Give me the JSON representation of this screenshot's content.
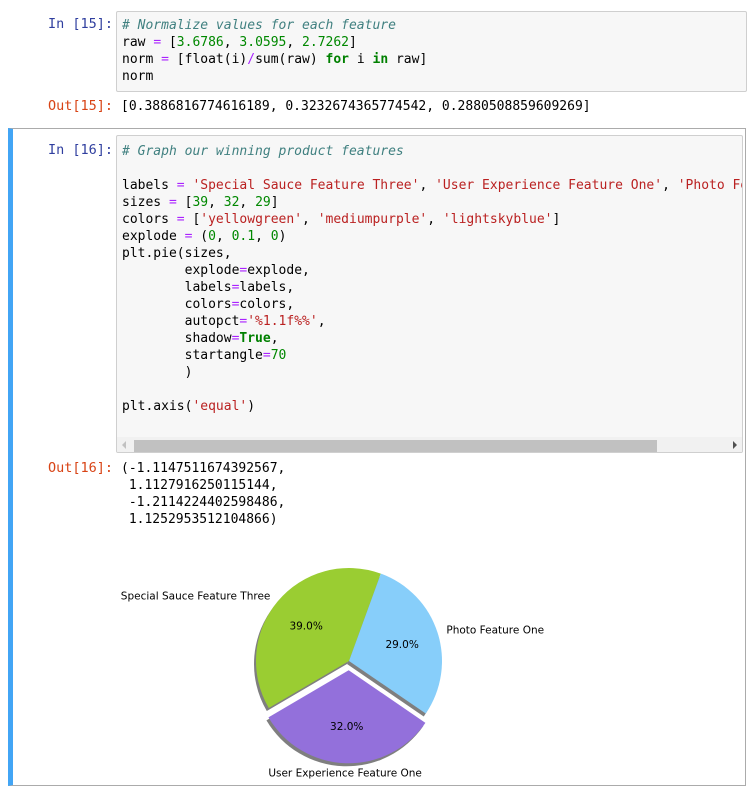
{
  "cells": [
    {
      "prompt_in": "In [15]:",
      "code_lines": [
        [
          {
            "t": "# Normalize values for each feature",
            "c": "cm"
          }
        ],
        [
          {
            "t": "raw "
          },
          {
            "t": "=",
            "c": "op"
          },
          {
            "t": " ["
          },
          {
            "t": "3.6786",
            "c": "num"
          },
          {
            "t": ", "
          },
          {
            "t": "3.0595",
            "c": "num"
          },
          {
            "t": ", "
          },
          {
            "t": "2.7262",
            "c": "num"
          },
          {
            "t": "]"
          }
        ],
        [
          {
            "t": "norm "
          },
          {
            "t": "=",
            "c": "op"
          },
          {
            "t": " [float(i)"
          },
          {
            "t": "/",
            "c": "op"
          },
          {
            "t": "sum(raw) "
          },
          {
            "t": "for",
            "c": "kw"
          },
          {
            "t": " i "
          },
          {
            "t": "in",
            "c": "kw"
          },
          {
            "t": " raw]"
          }
        ],
        [
          {
            "t": "norm"
          }
        ]
      ],
      "prompt_out": "Out[15]:",
      "output_lines": [
        "[0.3886816774616189, 0.3232674365774542, 0.2880508859609269]"
      ]
    },
    {
      "prompt_in": "In [16]:",
      "code_lines": [
        [
          {
            "t": "# Graph our winning product features",
            "c": "cm"
          }
        ],
        [
          {
            "t": ""
          }
        ],
        [
          {
            "t": "labels "
          },
          {
            "t": "=",
            "c": "op"
          },
          {
            "t": " "
          },
          {
            "t": "'Special Sauce Feature Three'",
            "c": "str"
          },
          {
            "t": ", "
          },
          {
            "t": "'User Experience Feature One'",
            "c": "str"
          },
          {
            "t": ", "
          },
          {
            "t": "'Photo Feature One'",
            "c": "str"
          }
        ],
        [
          {
            "t": "sizes "
          },
          {
            "t": "=",
            "c": "op"
          },
          {
            "t": " ["
          },
          {
            "t": "39",
            "c": "num"
          },
          {
            "t": ", "
          },
          {
            "t": "32",
            "c": "num"
          },
          {
            "t": ", "
          },
          {
            "t": "29",
            "c": "num"
          },
          {
            "t": "]"
          }
        ],
        [
          {
            "t": "colors "
          },
          {
            "t": "=",
            "c": "op"
          },
          {
            "t": " ["
          },
          {
            "t": "'yellowgreen'",
            "c": "str"
          },
          {
            "t": ", "
          },
          {
            "t": "'mediumpurple'",
            "c": "str"
          },
          {
            "t": ", "
          },
          {
            "t": "'lightskyblue'",
            "c": "str"
          },
          {
            "t": "]"
          }
        ],
        [
          {
            "t": "explode "
          },
          {
            "t": "=",
            "c": "op"
          },
          {
            "t": " ("
          },
          {
            "t": "0",
            "c": "num"
          },
          {
            "t": ", "
          },
          {
            "t": "0.1",
            "c": "num"
          },
          {
            "t": ", "
          },
          {
            "t": "0",
            "c": "num"
          },
          {
            "t": ")"
          }
        ],
        [
          {
            "t": "plt.pie(sizes,"
          }
        ],
        [
          {
            "t": "        explode"
          },
          {
            "t": "=",
            "c": "op"
          },
          {
            "t": "explode,"
          }
        ],
        [
          {
            "t": "        labels"
          },
          {
            "t": "=",
            "c": "op"
          },
          {
            "t": "labels,"
          }
        ],
        [
          {
            "t": "        colors"
          },
          {
            "t": "=",
            "c": "op"
          },
          {
            "t": "colors,"
          }
        ],
        [
          {
            "t": "        autopct"
          },
          {
            "t": "=",
            "c": "op"
          },
          {
            "t": "'%1.1f%%'",
            "c": "str"
          },
          {
            "t": ","
          }
        ],
        [
          {
            "t": "        shadow"
          },
          {
            "t": "=",
            "c": "op"
          },
          {
            "t": "True",
            "c": "kw"
          },
          {
            "t": ","
          }
        ],
        [
          {
            "t": "        startangle"
          },
          {
            "t": "=",
            "c": "op"
          },
          {
            "t": "70",
            "c": "num"
          }
        ],
        [
          {
            "t": "        )"
          }
        ],
        [
          {
            "t": ""
          }
        ],
        [
          {
            "t": "plt.axis("
          },
          {
            "t": "'equal'",
            "c": "str"
          },
          {
            "t": ")"
          }
        ]
      ],
      "prompt_out": "Out[16]:",
      "output_lines": [
        "(-1.1147511674392567,",
        " 1.1127916250115144,",
        " -1.2114224402598486,",
        " 1.1252953512104866)"
      ]
    }
  ],
  "chart_data": {
    "type": "pie",
    "title": "",
    "startangle": 70,
    "shadow": true,
    "categories": [
      "Special Sauce Feature Three",
      "User Experience Feature One",
      "Photo Feature One"
    ],
    "values": [
      39,
      32,
      29
    ],
    "colors": [
      "#9acd32",
      "#9370db",
      "#87cefa"
    ],
    "explode": [
      0,
      0.1,
      0
    ],
    "autopct_labels": [
      "39.0%",
      "32.0%",
      "29.0%"
    ],
    "axis": "equal"
  }
}
